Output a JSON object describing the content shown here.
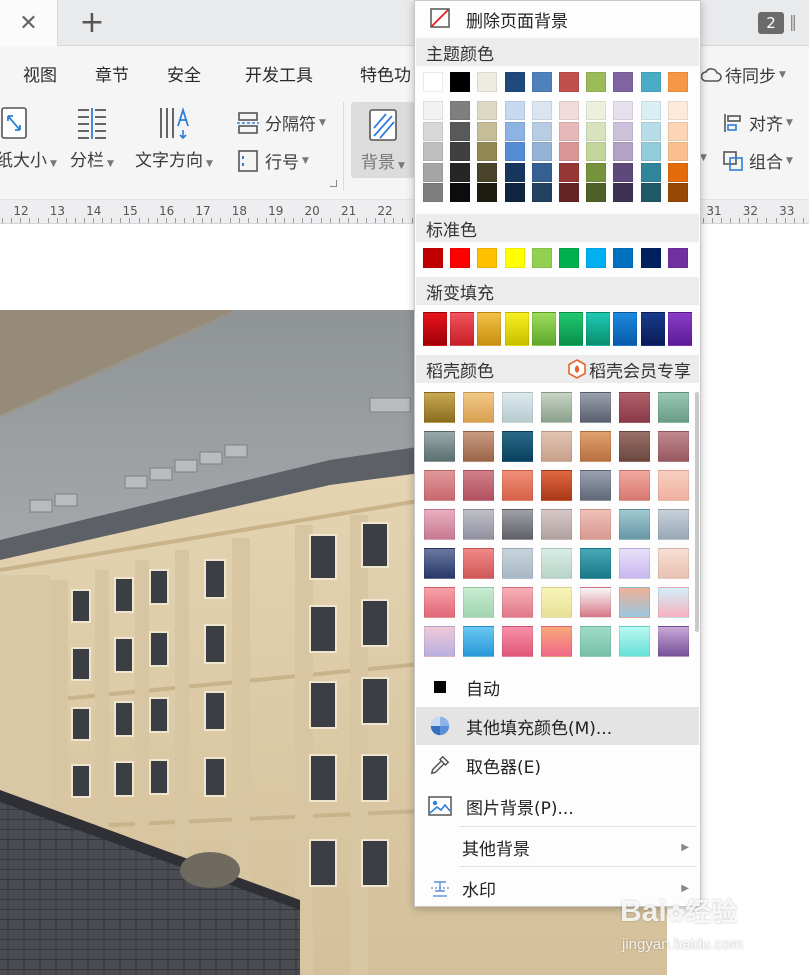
{
  "tabbar": {
    "close_symbol": "✕",
    "new_symbol": "+",
    "window_count": "2"
  },
  "menu_tabs": [
    "视图",
    "章节",
    "安全",
    "开发工具",
    "特色功"
  ],
  "ribbon": {
    "right_tab": "待同步",
    "size_label": "纸大小",
    "columns_label": "分栏",
    "text_dir_label": "文字方向",
    "separator_label": "分隔符",
    "line_no_label": "行号",
    "background_label": "背景",
    "align_label": "对齐",
    "group_label": "组合"
  },
  "ruler": {
    "left_numbers": [
      "12",
      "13",
      "14",
      "15",
      "16",
      "17",
      "18",
      "19",
      "20",
      "21",
      "22"
    ],
    "right_numbers": [
      "31",
      "32",
      "33"
    ]
  },
  "panel": {
    "delete_bg_label": "删除页面背景",
    "theme_colors_title": "主题颜色",
    "standard_colors_title": "标准色",
    "gradient_title": "渐变填充",
    "docer_colors_title": "稻壳颜色",
    "docer_vip_label": "稻壳会员专享",
    "auto_label": "自动",
    "more_fill_label": "其他填充颜色(M)...",
    "eyedropper_label": "取色器(E)",
    "picture_bg_label": "图片背景(P)...",
    "other_bg_label": "其他背景",
    "watermark_label": "水印"
  },
  "theme_colors_top": [
    "#ffffff",
    "#000000",
    "#eeece1",
    "#1f497d",
    "#4f81bd",
    "#c0504d",
    "#9bbb59",
    "#8064a2",
    "#4bacc6",
    "#f79646"
  ],
  "theme_colors_shades": [
    [
      "#f2f2f2",
      "#7f7f7f",
      "#ddd9c3",
      "#c6d9f0",
      "#dbe5f1",
      "#f2dcdb",
      "#ebf1dd",
      "#e5e0ec",
      "#dbeef3",
      "#fdeada"
    ],
    [
      "#d8d8d8",
      "#595959",
      "#c4bd97",
      "#8db3e2",
      "#b8cce4",
      "#e5b9b7",
      "#d7e3bc",
      "#ccc1d9",
      "#b7dde8",
      "#fbd5b5"
    ],
    [
      "#bfbfbf",
      "#3f3f3f",
      "#938953",
      "#548dd4",
      "#95b3d7",
      "#d99694",
      "#c3d69b",
      "#b2a2c7",
      "#92cddc",
      "#fac08f"
    ],
    [
      "#a5a5a5",
      "#262626",
      "#494429",
      "#17365d",
      "#366092",
      "#953734",
      "#76923c",
      "#5f497a",
      "#31859b",
      "#e36c09"
    ],
    [
      "#7f7f7f",
      "#0c0c0c",
      "#1d1b10",
      "#0f243e",
      "#244061",
      "#632423",
      "#4f6128",
      "#3f3151",
      "#205867",
      "#974806"
    ]
  ],
  "standard_colors": [
    "#c00000",
    "#ff0000",
    "#ffc000",
    "#ffff00",
    "#92d050",
    "#00b050",
    "#00b0f0",
    "#0070c0",
    "#002060",
    "#7030a0"
  ],
  "gradient_colors": [
    [
      "#e8141c",
      "#a00008"
    ],
    [
      "#f0545c",
      "#c81e28"
    ],
    [
      "#f2c146",
      "#c8900e"
    ],
    [
      "#f8f020",
      "#c8c000"
    ],
    [
      "#9edc5a",
      "#5fa82c"
    ],
    [
      "#20c870",
      "#08904a"
    ],
    [
      "#20c8b4",
      "#08906e"
    ],
    [
      "#1a8ae0",
      "#0a5aa8"
    ],
    [
      "#183c8c",
      "#0a1c58"
    ],
    [
      "#8c3cc8",
      "#5a1c96"
    ]
  ],
  "docer_colors": [
    [
      [
        "#c8a850",
        "#8a6e20"
      ],
      [
        "#f0c888",
        "#d8a050"
      ],
      [
        "#dce8ec",
        "#b8ccd0"
      ],
      [
        "#c8d4c4",
        "#8aa08c"
      ],
      [
        "#9aa0ac",
        "#5a6070"
      ],
      [
        "#b0606a",
        "#8a3a48"
      ],
      [
        "#98c8b4",
        "#6a9c88"
      ]
    ],
    [
      [
        "#98a8a8",
        "#5a7070"
      ],
      [
        "#c89a80",
        "#9a6448"
      ],
      [
        "#2a6a88",
        "#0a4060"
      ],
      [
        "#e0c4b0",
        "#c8a08c"
      ],
      [
        "#e0a070",
        "#b87040"
      ],
      [
        "#9a7068",
        "#6a4840"
      ],
      [
        "#c08890",
        "#985a60"
      ]
    ],
    [
      [
        "#e09898",
        "#c86870"
      ],
      [
        "#d08088",
        "#b05060"
      ],
      [
        "#f09078",
        "#d86048"
      ],
      [
        "#e06840",
        "#a83818"
      ],
      [
        "#9aa0b0",
        "#606878"
      ],
      [
        "#f0a8a0",
        "#d87870"
      ],
      [
        "#f8d0c0",
        "#f0b0a0"
      ]
    ],
    [
      [
        "#e8b0c0",
        "#c87890"
      ],
      [
        "#c0c0c8",
        "#9090a0"
      ],
      [
        "#a0a0a8",
        "#606068"
      ],
      [
        "#d8c8c8",
        "#b0a0a0"
      ],
      [
        "#f0c0b8",
        "#d89890"
      ],
      [
        "#a0c8d0",
        "#6898a8"
      ],
      [
        "#c8d0d8",
        "#98a8b8"
      ]
    ],
    [
      [
        "#6878a0",
        "#283868"
      ],
      [
        "#f08888",
        "#d05858"
      ],
      [
        "#c8d4dc",
        "#a8b8c4"
      ],
      [
        "#d8ece4",
        "#b8d4c8"
      ],
      [
        "#48a8b8",
        "#1a7888"
      ],
      [
        "#e8e0f8",
        "#c8b8f0"
      ],
      [
        "#f8e0d4",
        "#e8c0b0"
      ]
    ],
    [
      [
        "#f8a0a8",
        "#e06878"
      ],
      [
        "#c8ecd0",
        "#a0d4b0"
      ],
      [
        "#f8b0b8",
        "#e07888"
      ],
      [
        "#f8f4b8",
        "#e8e098"
      ],
      [
        "#f8f8f8",
        "#d87888"
      ],
      [
        "#f0b098",
        "#98c8e0"
      ],
      [
        "#d0f0f8",
        "#f8b0c0"
      ]
    ],
    [
      [
        "#f0c8d8",
        "#b8b0e0"
      ],
      [
        "#68c8f0",
        "#2898d8"
      ],
      [
        "#f890a8",
        "#e05878"
      ],
      [
        "#f8a878",
        "#f06888"
      ],
      [
        "#a0dcc8",
        "#78c0a8"
      ],
      [
        "#b8f8f0",
        "#68e0d8"
      ],
      [
        "#c8a8d8",
        "#785098"
      ]
    ]
  ],
  "watermark": {
    "brand": "Bai",
    "brand_tail": "经验",
    "url": "jingyan.baidu.com"
  }
}
